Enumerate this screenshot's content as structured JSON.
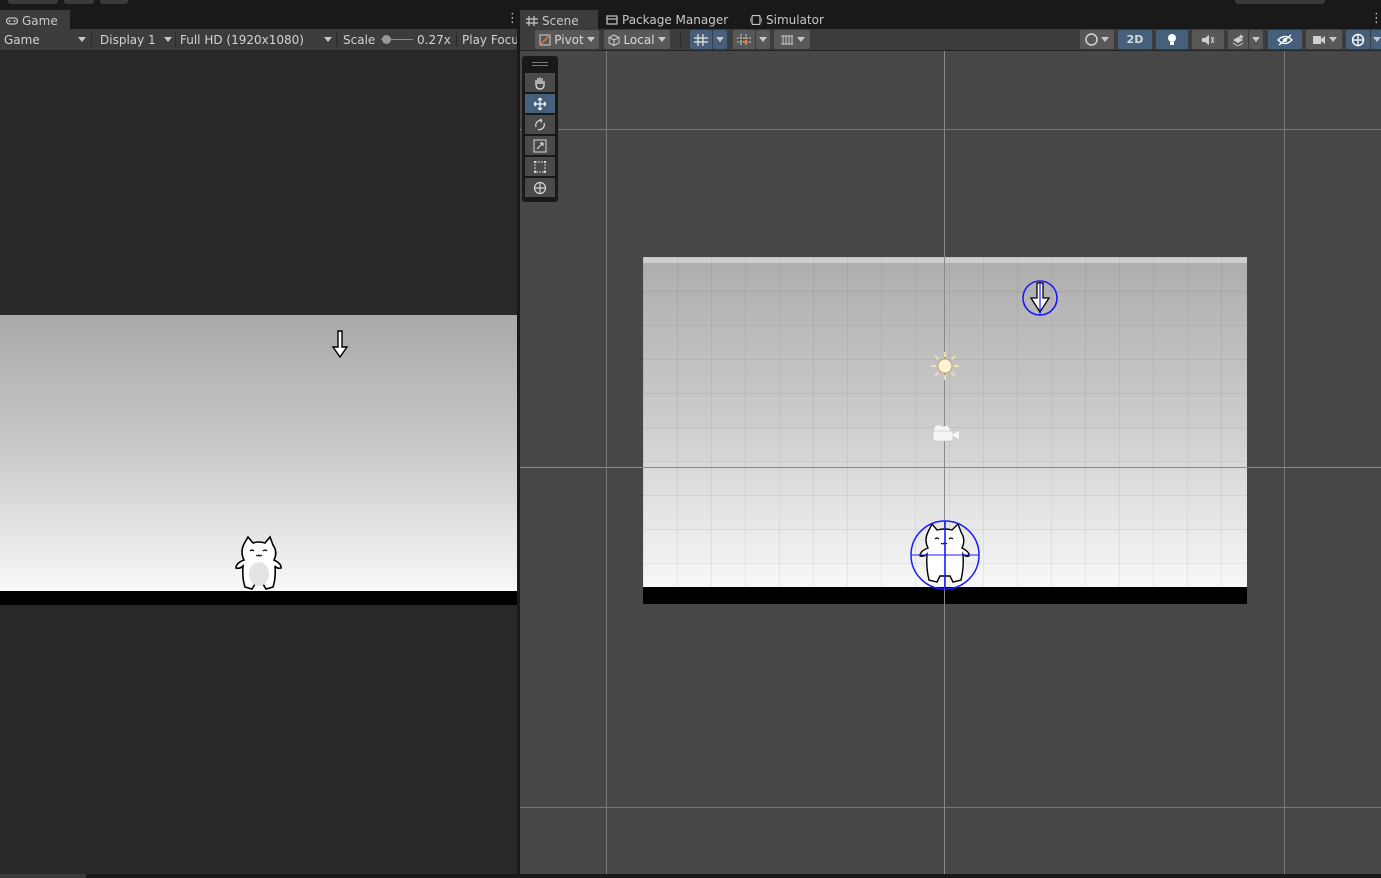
{
  "game_panel": {
    "tab_label": "Game",
    "toolbar": {
      "view_dropdown": "Game",
      "display_dropdown": "Display 1",
      "resolution_dropdown": "Full HD (1920x1080)",
      "scale_label": "Scale",
      "scale_value": "0.27x",
      "scale_fraction": 0.27,
      "play_focus_label": "Play Focu"
    }
  },
  "scene_panel": {
    "tabs": [
      {
        "label": "Scene",
        "icon": "grid-icon"
      },
      {
        "label": "Package Manager",
        "icon": "package-icon"
      },
      {
        "label": "Simulator",
        "icon": "simulator-icon"
      }
    ],
    "toolbar": {
      "pivot_label": "Pivot",
      "local_label": "Local",
      "mode_2d_label": "2D"
    },
    "tools": [
      "hand-tool",
      "move-tool",
      "rotate-tool",
      "scale-tool",
      "rect-tool",
      "transform-tool"
    ]
  },
  "colors": {
    "panel_bg": "#282828",
    "scene_bg": "#474747",
    "tab_strip": "#191919",
    "toolbar": "#3c3c3c",
    "accent_blue": "#46607c",
    "gizmo_blue": "#0000ff"
  }
}
